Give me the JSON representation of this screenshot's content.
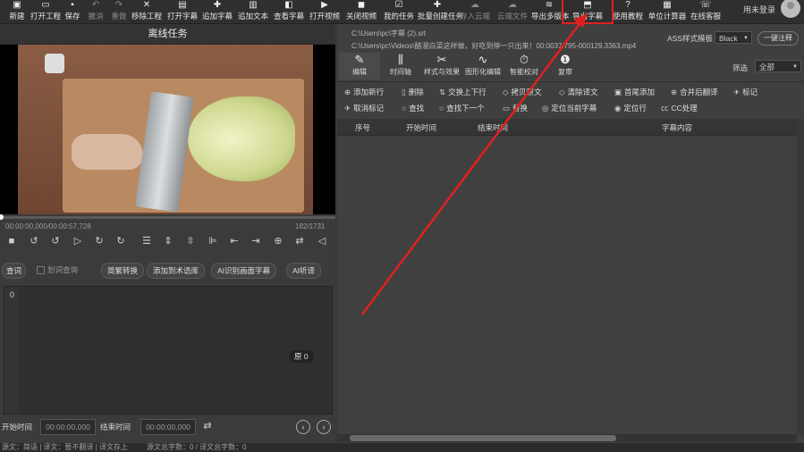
{
  "toolbar": {
    "items": [
      {
        "label": "新建",
        "icon": "new-icon",
        "enabled": true
      },
      {
        "label": "打开工程",
        "icon": "open-project-icon",
        "enabled": true
      },
      {
        "label": "保存",
        "icon": "save-icon",
        "enabled": true
      },
      {
        "label": "撤消",
        "icon": "undo-icon",
        "enabled": false
      },
      {
        "label": "重做",
        "icon": "redo-icon",
        "enabled": false
      },
      {
        "label": "移除工程",
        "icon": "remove-project-icon",
        "enabled": true
      },
      {
        "label": "打开字幕",
        "icon": "open-subtitle-icon",
        "enabled": true
      },
      {
        "label": "追加字幕",
        "icon": "append-subtitle-icon",
        "enabled": true
      },
      {
        "label": "追加文本",
        "icon": "append-text-icon",
        "enabled": true
      },
      {
        "label": "查看字幕",
        "icon": "view-subtitle-icon",
        "enabled": true
      },
      {
        "label": "打开视频",
        "icon": "open-video-icon",
        "enabled": true
      },
      {
        "label": "关闭视频",
        "icon": "close-video-icon",
        "enabled": true
      },
      {
        "label": "我的任务",
        "icon": "my-tasks-icon",
        "enabled": true
      },
      {
        "label": "批量创建任务",
        "icon": "batch-task-icon",
        "enabled": true
      },
      {
        "label": "存入云端",
        "icon": "cloud-save-icon",
        "enabled": false
      },
      {
        "label": "云端文件",
        "icon": "cloud-files-icon",
        "enabled": false
      },
      {
        "label": "导出多版本",
        "icon": "export-multi-icon",
        "enabled": true
      },
      {
        "label": "导出字幕",
        "icon": "export-subtitle-icon",
        "enabled": true
      },
      {
        "label": "使用教程",
        "icon": "tutorial-icon",
        "enabled": true
      },
      {
        "label": "单位计算器",
        "icon": "calculator-icon",
        "enabled": true
      },
      {
        "label": "在线客服",
        "icon": "support-icon",
        "enabled": true
      }
    ],
    "user_label": "用未登录"
  },
  "left": {
    "title": "离线任务",
    "time_current": "00:00:00,000/00:00:57,728",
    "frame_counter": "182/1731",
    "buttons": [
      "查词",
      "划词查询",
      "简繁转换",
      "添加到术语库",
      "AI识别画面字幕",
      "AI听译"
    ],
    "line_number": "0",
    "orig_badge": "原 0",
    "start_label": "开始时间",
    "start_value": "00:00:00,000",
    "end_label": "结束时间",
    "end_value": "00:00:00,000"
  },
  "status": {
    "text_left": "源文：简语 | 译文：暂不翻译 | 译文存上",
    "text_right": "源文总字数：0 / 译文总字数：0"
  },
  "right": {
    "file1": "C:\\Users\\pc\\字幕 (2).srt",
    "file2": "C:\\Users\\pc\\Videos\\醋溜白菜这样做，好吃到停一只出来！00:0037.795-000129.3363.mp4",
    "ass_label": "ASS样式模板",
    "ass_value": "Black",
    "onekey_label": "一键注释",
    "tabs": [
      {
        "label": "编辑",
        "icon": "edit-icon"
      },
      {
        "label": "时间轴",
        "icon": "timeline-icon"
      },
      {
        "label": "样式与效果",
        "icon": "style-effect-icon"
      },
      {
        "label": "图形化编辑",
        "icon": "graph-edit-icon"
      },
      {
        "label": "智能校对",
        "icon": "smart-check-icon"
      },
      {
        "label": "复审",
        "icon": "review-icon"
      }
    ],
    "filter_label": "筛选",
    "filter_value": "全部",
    "actions_row1": [
      {
        "label": "添加新行",
        "icon": "add-row-icon"
      },
      {
        "label": "删除",
        "icon": "delete-icon"
      },
      {
        "label": "交换上下行",
        "icon": "swap-rows-icon"
      },
      {
        "label": "拷贝原文",
        "icon": "copy-source-icon"
      },
      {
        "label": "清除译文",
        "icon": "clear-translation-icon"
      },
      {
        "label": "首尾添加",
        "icon": "prefix-suffix-icon"
      },
      {
        "label": "合并后翻译",
        "icon": "merge-translate-icon"
      },
      {
        "label": "标记",
        "icon": "mark-icon"
      }
    ],
    "actions_row2": [
      {
        "label": "取消标记",
        "icon": "unmark-icon"
      },
      {
        "label": "查找",
        "icon": "find-icon"
      },
      {
        "label": "查找下一个",
        "icon": "find-next-icon"
      },
      {
        "label": "替换",
        "icon": "replace-icon"
      },
      {
        "label": "定位当前字幕",
        "icon": "locate-current-icon"
      },
      {
        "label": "定位行",
        "icon": "locate-row-icon"
      },
      {
        "label": "CC处理",
        "icon": "cc-icon"
      }
    ],
    "columns": [
      "序号",
      "开始时间",
      "结束时间",
      "字幕内容"
    ]
  },
  "colors": {
    "annotation": "#e02020",
    "background": "#3a3a3a"
  }
}
